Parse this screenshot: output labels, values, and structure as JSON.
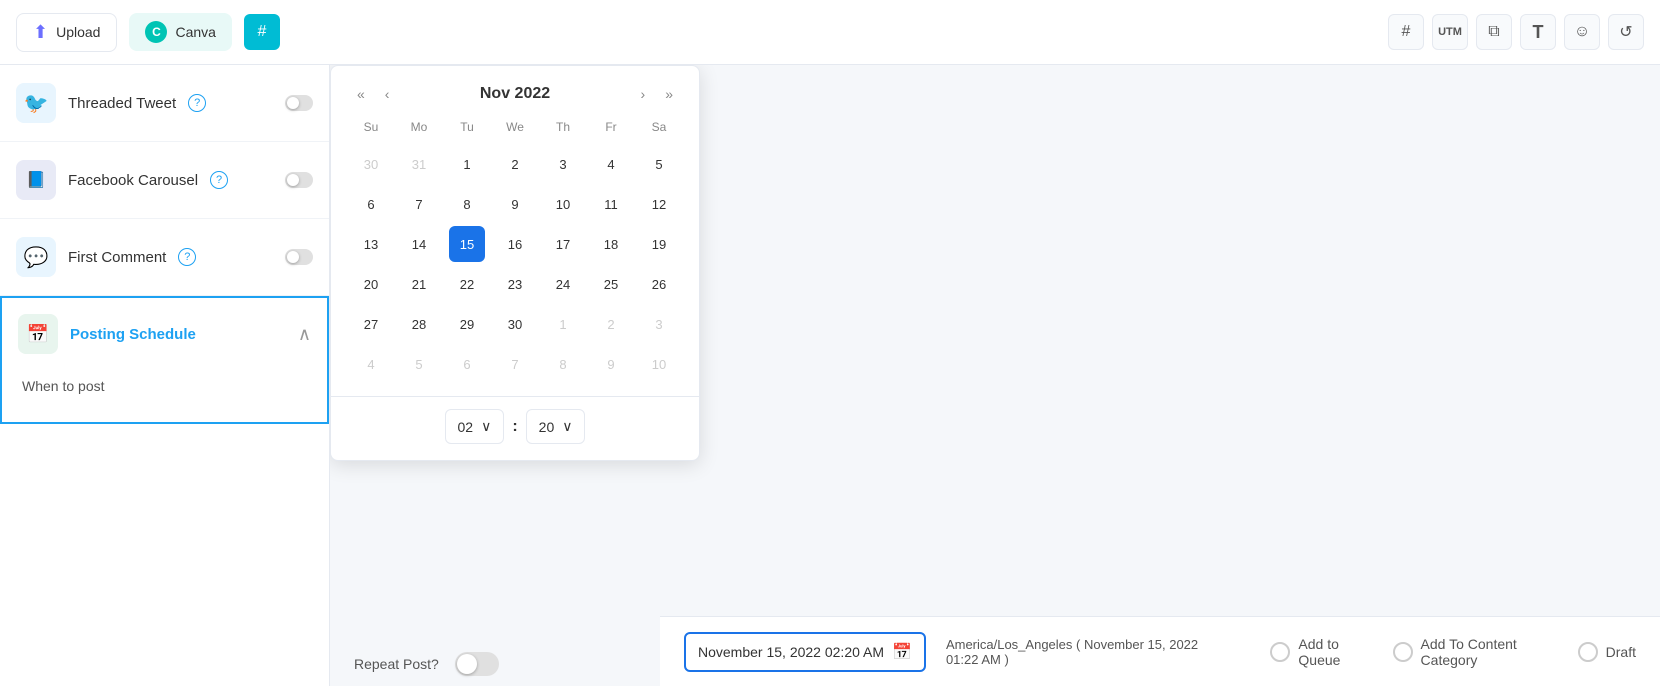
{
  "toolbar": {
    "upload_label": "Upload",
    "canva_label": "Canva",
    "active_tab": "#",
    "icons": {
      "hashtag": "#",
      "utm": "UTM",
      "layers": "⧉",
      "text": "T",
      "emoji": "☺",
      "refresh": "↺"
    }
  },
  "sidebar": {
    "items": [
      {
        "id": "threaded-tweet",
        "label": "Threaded Tweet",
        "icon_type": "twitter"
      },
      {
        "id": "facebook-carousel",
        "label": "Facebook Carousel",
        "icon_type": "facebook"
      },
      {
        "id": "first-comment",
        "label": "First Comment",
        "icon_type": "comment"
      }
    ],
    "posting_schedule": {
      "title": "Posting Schedule",
      "when_to_post": "When to post",
      "repeat_post": "Repeat Post?"
    }
  },
  "calendar": {
    "month": "Nov",
    "year": "2022",
    "day_headers": [
      "Su",
      "Mo",
      "Tu",
      "We",
      "Th",
      "Fr",
      "Sa"
    ],
    "nav": {
      "prev_prev": "«",
      "prev": "‹",
      "next": "›",
      "next_next": "»"
    },
    "weeks": [
      [
        {
          "day": "30",
          "month": "other"
        },
        {
          "day": "31",
          "month": "other"
        },
        {
          "day": "1",
          "month": "current"
        },
        {
          "day": "2",
          "month": "current"
        },
        {
          "day": "3",
          "month": "current"
        },
        {
          "day": "4",
          "month": "current"
        },
        {
          "day": "5",
          "month": "current"
        }
      ],
      [
        {
          "day": "6",
          "month": "current"
        },
        {
          "day": "7",
          "month": "current"
        },
        {
          "day": "8",
          "month": "current"
        },
        {
          "day": "9",
          "month": "current"
        },
        {
          "day": "10",
          "month": "current"
        },
        {
          "day": "11",
          "month": "current"
        },
        {
          "day": "12",
          "month": "current"
        }
      ],
      [
        {
          "day": "13",
          "month": "current"
        },
        {
          "day": "14",
          "month": "current"
        },
        {
          "day": "15",
          "month": "current",
          "selected": true
        },
        {
          "day": "16",
          "month": "current"
        },
        {
          "day": "17",
          "month": "current"
        },
        {
          "day": "18",
          "month": "current"
        },
        {
          "day": "19",
          "month": "current"
        }
      ],
      [
        {
          "day": "20",
          "month": "current"
        },
        {
          "day": "21",
          "month": "current"
        },
        {
          "day": "22",
          "month": "current"
        },
        {
          "day": "23",
          "month": "current"
        },
        {
          "day": "24",
          "month": "current"
        },
        {
          "day": "25",
          "month": "current"
        },
        {
          "day": "26",
          "month": "current"
        }
      ],
      [
        {
          "day": "27",
          "month": "current"
        },
        {
          "day": "28",
          "month": "current"
        },
        {
          "day": "29",
          "month": "current"
        },
        {
          "day": "30",
          "month": "current"
        },
        {
          "day": "1",
          "month": "next"
        },
        {
          "day": "2",
          "month": "next"
        },
        {
          "day": "3",
          "month": "next"
        }
      ],
      [
        {
          "day": "4",
          "month": "next"
        },
        {
          "day": "5",
          "month": "next"
        },
        {
          "day": "6",
          "month": "next"
        },
        {
          "day": "7",
          "month": "next"
        },
        {
          "day": "8",
          "month": "next"
        },
        {
          "day": "9",
          "month": "next"
        },
        {
          "day": "10",
          "month": "next"
        }
      ]
    ],
    "time": {
      "hour": "02",
      "minute": "20"
    }
  },
  "date_input": {
    "value": "November 15, 2022 02:20 AM",
    "timezone": "America/Los_Angeles ( November 15, 2022 01:22 AM )"
  },
  "radio_options": [
    {
      "id": "add-to-queue",
      "label": "Add to Queue"
    },
    {
      "id": "add-to-content-category",
      "label": "Add To Content Category"
    },
    {
      "id": "draft",
      "label": "Draft"
    }
  ]
}
